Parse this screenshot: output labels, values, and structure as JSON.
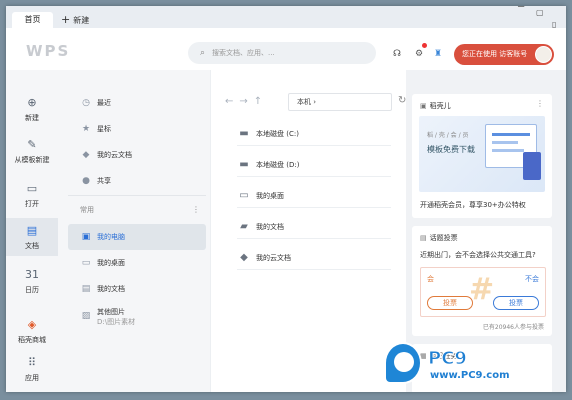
{
  "tabs": {
    "home": "首页",
    "new_plus": "+",
    "new": "新建"
  },
  "header": {
    "logo": "WPS",
    "search_placeholder": "搜索文档、应用、...",
    "user_status": "您正在使用",
    "user_name": "访客账号"
  },
  "rail": [
    {
      "label": "新建",
      "icon": "⊕"
    },
    {
      "label": "从模板新建",
      "icon": "✎"
    },
    {
      "label": "打开",
      "icon": "▭"
    },
    {
      "label": "文档",
      "icon": "▤"
    },
    {
      "label": "日历",
      "icon": "31"
    },
    {
      "label": "稻壳商城",
      "icon": "◈"
    },
    {
      "label": "应用",
      "icon": "⠿"
    }
  ],
  "nav": {
    "top": [
      {
        "label": "最近",
        "icon": "◷"
      },
      {
        "label": "星标",
        "icon": "★"
      },
      {
        "label": "我的云文档",
        "icon": "◆"
      },
      {
        "label": "共享",
        "icon": "●"
      }
    ],
    "section_label": "常用",
    "section_more": "⋮",
    "common": [
      {
        "label": "我的电脑",
        "icon": "▣"
      },
      {
        "label": "我的桌面",
        "icon": "▭"
      },
      {
        "label": "我的文档",
        "icon": "▤"
      },
      {
        "label": "其他图片",
        "sub": "D:\\图片素材",
        "icon": "▨"
      }
    ]
  },
  "main": {
    "nav_arrows": "←→↑",
    "path": "本机",
    "path_arrow": "›",
    "refresh": "↻",
    "files": [
      {
        "name": "本地磁盘 (C:)",
        "icon": "▬"
      },
      {
        "name": "本地磁盘 (D:)",
        "icon": "▬"
      },
      {
        "name": "我的桌面",
        "icon": "▭"
      },
      {
        "name": "我的文档",
        "icon": "▰"
      },
      {
        "name": "我的云文档",
        "icon": "◆"
      }
    ]
  },
  "right": {
    "card1": {
      "title": "稻壳儿",
      "more": "⋮",
      "banner_line1": "稻 / 壳 / 会 / 员",
      "banner_line2": "模板免费下载",
      "footer": "开通稻壳会员，尊享30+办公特权"
    },
    "card2": {
      "title": "话题投票",
      "question": "近期出门，会不会选择公共交通工具?",
      "opt_yes": "会",
      "opt_no": "不会",
      "vote": "投票",
      "stat": "已有20946人参与投票"
    },
    "card3": {
      "title": "每日任务"
    }
  },
  "watermark": {
    "brand": "PC9软件园",
    "url": "www.PC9.com"
  }
}
